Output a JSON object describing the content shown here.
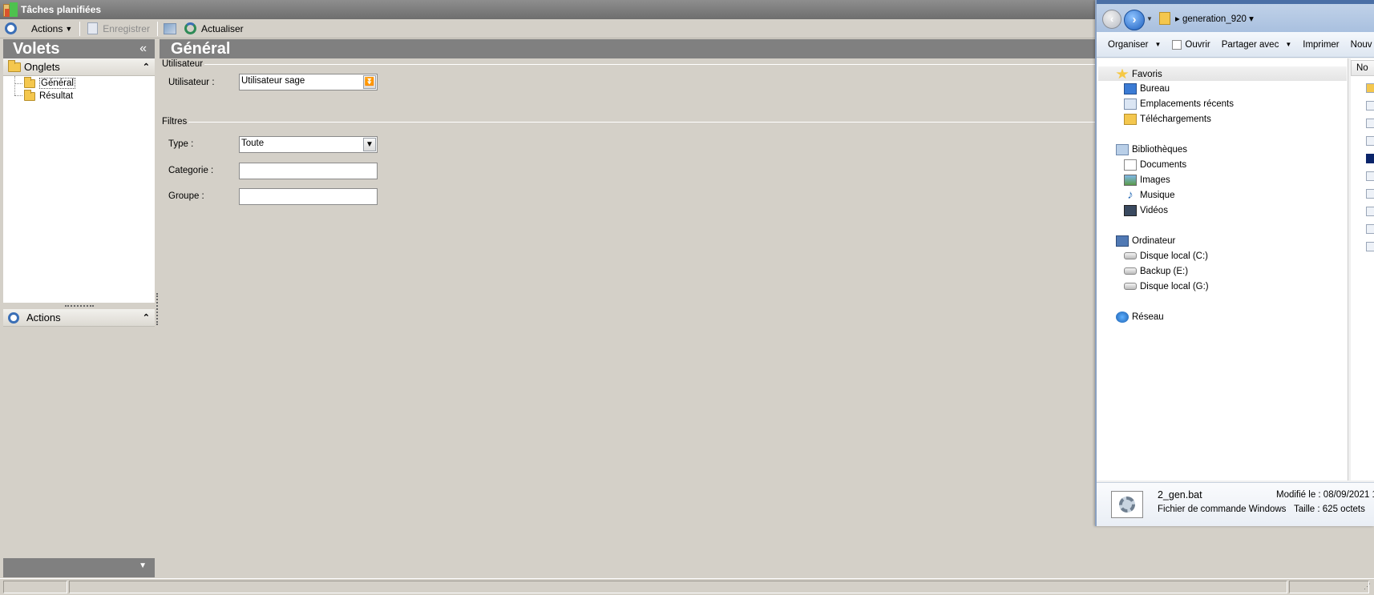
{
  "window": {
    "title": "Tâches planifiées"
  },
  "toolbar": {
    "actions_label": "Actions",
    "save_label": "Enregistrer",
    "refresh_label": "Actualiser"
  },
  "left_panel": {
    "title": "Volets",
    "collapse_glyph": "«",
    "tabs_section": {
      "title": "Onglets",
      "items": [
        {
          "label": "Général",
          "selected": true
        },
        {
          "label": "Résultat",
          "selected": false
        }
      ]
    },
    "actions_section": {
      "title": "Actions"
    }
  },
  "main": {
    "title": "Général",
    "user_group": {
      "title": "Utilisateur",
      "user_label": "Utilisateur :",
      "user_value": "Utilisateur sage"
    },
    "filters_group": {
      "title": "Filtres",
      "type_label": "Type :",
      "type_value": "Toute",
      "category_label": "Categorie :",
      "category_value": "",
      "group_label": "Groupe :",
      "group_value": ""
    }
  },
  "explorer": {
    "address": "generation_920",
    "commands": [
      "Organiser",
      "Ouvrir",
      "Partager avec",
      "Imprimer",
      "Nouv"
    ],
    "column_header": "No",
    "nav": {
      "favorites": "Favoris",
      "favorites_items": [
        "Bureau",
        "Emplacements récents",
        "Téléchargements"
      ],
      "libraries": "Bibliothèques",
      "libraries_items": [
        "Documents",
        "Images",
        "Musique",
        "Vidéos"
      ],
      "computer": "Ordinateur",
      "computer_items": [
        "Disque local (C:)",
        "Backup (E:)",
        "Disque local (G:)"
      ],
      "network": "Réseau"
    },
    "details": {
      "file_name": "2_gen.bat",
      "file_type": "Fichier de commande Windows",
      "modified": "Modifié le : 08/09/2021 1",
      "size": "Taille : 625 octets"
    }
  },
  "icons": {
    "actions": "actions-circle-icon",
    "save": "save-document-icon",
    "refresh": "refresh-icon",
    "folder": "folder-icon",
    "back": "back-arrow-icon",
    "forward": "forward-arrow-icon"
  },
  "colors": {
    "header_grey": "#808080",
    "window_bg": "#d4d0c8",
    "accent_blue": "#3b6fb6"
  }
}
